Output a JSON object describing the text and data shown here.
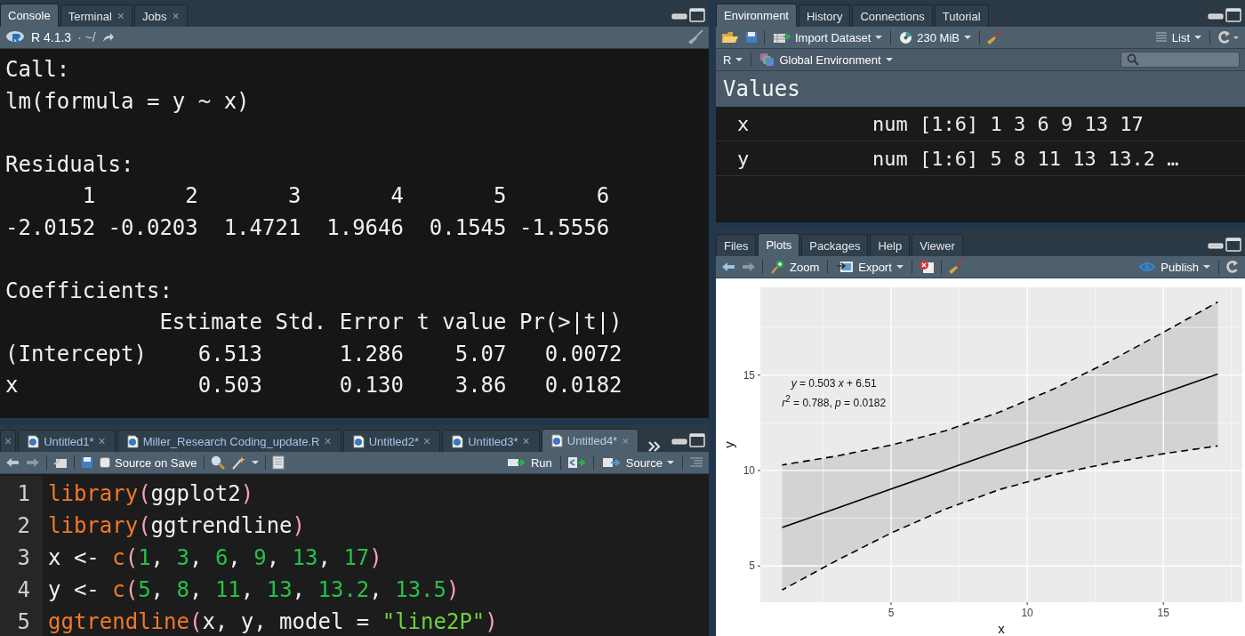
{
  "console": {
    "tabs": [
      {
        "label": "Console",
        "selected": true
      },
      {
        "label": "Terminal",
        "selected": false,
        "close": "×"
      },
      {
        "label": "Jobs",
        "selected": false,
        "close": "×"
      }
    ],
    "toolbar": {
      "version": "R 4.1.3",
      "path": "· ~/"
    },
    "output": [
      [
        "Call:",
        "lm(formula = y ~ x)"
      ],
      [
        "Residuals:",
        "      1       2       3       4       5       6 ",
        "-2.0152 -0.0203  1.4721  1.9646  0.1545 -1.5556 "
      ],
      [
        "Coefficients:",
        "            Estimate Std. Error t value Pr(>|t|)",
        "(Intercept)    6.513      1.286    5.07   0.0072",
        "x              0.503      0.130    3.86   0.0182"
      ]
    ]
  },
  "editor": {
    "tabs": [
      {
        "close": "×",
        "selected": false
      },
      {
        "label": "Untitled1*",
        "close": "×",
        "selected": false
      },
      {
        "label": "Miller_Research Coding_update.R",
        "close": "×",
        "selected": false
      },
      {
        "label": "Untitled2*",
        "close": "×",
        "selected": false
      },
      {
        "label": "Untitled3*",
        "close": "×",
        "selected": false
      },
      {
        "label": "Untitled4*",
        "close": "×",
        "selected": true
      }
    ],
    "toolbar": {
      "source_on_save": {
        "label": "Source on Save",
        "checked": false
      },
      "run": "Run",
      "source": "Source"
    },
    "lines": [
      {
        "number": "1",
        "tokens": [
          {
            "kind": "func",
            "text": "library"
          },
          {
            "kind": "paren",
            "text": "("
          },
          {
            "kind": "plain",
            "text": "ggplot2"
          },
          {
            "kind": "paren",
            "text": ")"
          }
        ]
      },
      {
        "number": "2",
        "tokens": [
          {
            "kind": "func",
            "text": "library"
          },
          {
            "kind": "paren",
            "text": "("
          },
          {
            "kind": "plain",
            "text": "ggtrendline"
          },
          {
            "kind": "paren",
            "text": ")"
          }
        ]
      },
      {
        "number": "3",
        "tokens": [
          {
            "kind": "plain",
            "text": "x <- "
          },
          {
            "kind": "func",
            "text": "c"
          },
          {
            "kind": "paren",
            "text": "("
          },
          {
            "kind": "number",
            "text": "1"
          },
          {
            "kind": "plain",
            "text": ", "
          },
          {
            "kind": "number",
            "text": "3"
          },
          {
            "kind": "plain",
            "text": ", "
          },
          {
            "kind": "number",
            "text": "6"
          },
          {
            "kind": "plain",
            "text": ", "
          },
          {
            "kind": "number",
            "text": "9"
          },
          {
            "kind": "plain",
            "text": ", "
          },
          {
            "kind": "number",
            "text": "13"
          },
          {
            "kind": "plain",
            "text": ", "
          },
          {
            "kind": "number",
            "text": "17"
          },
          {
            "kind": "paren",
            "text": ")"
          }
        ]
      },
      {
        "number": "4",
        "tokens": [
          {
            "kind": "plain",
            "text": "y <- "
          },
          {
            "kind": "func",
            "text": "c"
          },
          {
            "kind": "paren",
            "text": "("
          },
          {
            "kind": "number",
            "text": "5"
          },
          {
            "kind": "plain",
            "text": ", "
          },
          {
            "kind": "number",
            "text": "8"
          },
          {
            "kind": "plain",
            "text": ", "
          },
          {
            "kind": "number",
            "text": "11"
          },
          {
            "kind": "plain",
            "text": ", "
          },
          {
            "kind": "number",
            "text": "13"
          },
          {
            "kind": "plain",
            "text": ", "
          },
          {
            "kind": "number",
            "text": "13.2"
          },
          {
            "kind": "plain",
            "text": ", "
          },
          {
            "kind": "number",
            "text": "13.5"
          },
          {
            "kind": "paren",
            "text": ")"
          }
        ]
      },
      {
        "number": "5",
        "tokens": [
          {
            "kind": "func",
            "text": "ggtrendline"
          },
          {
            "kind": "paren",
            "text": "("
          },
          {
            "kind": "plain",
            "text": "x, y, model = "
          },
          {
            "kind": "string",
            "text": "\"line2P\""
          },
          {
            "kind": "paren",
            "text": ")"
          }
        ]
      }
    ]
  },
  "environment": {
    "tabs": [
      {
        "label": "Environment",
        "selected": true
      },
      {
        "label": "History",
        "selected": false
      },
      {
        "label": "Connections",
        "selected": false
      },
      {
        "label": "Tutorial",
        "selected": false
      }
    ],
    "toolbar": {
      "import": "Import Dataset",
      "memory": "230 MiB",
      "view": "List"
    },
    "scope": {
      "language": "R",
      "environment": "Global Environment"
    },
    "section": "Values",
    "rows": [
      {
        "name": "x",
        "value": "num [1:6] 1 3 6 9 13 17"
      },
      {
        "name": "y",
        "value": "num [1:6] 5 8 11 13 13.2 …"
      }
    ]
  },
  "plots": {
    "tabs": [
      {
        "label": "Files",
        "selected": false
      },
      {
        "label": "Plots",
        "selected": true
      },
      {
        "label": "Packages",
        "selected": false
      },
      {
        "label": "Help",
        "selected": false
      },
      {
        "label": "Viewer",
        "selected": false
      }
    ],
    "toolbar": {
      "zoom": "Zoom",
      "export": "Export",
      "publish": "Publish"
    },
    "chart_data": {
      "type": "line",
      "xlabel": "x",
      "ylabel": "y",
      "grid": true,
      "x": [
        1,
        3,
        5,
        7,
        9,
        11,
        13,
        15,
        17
      ],
      "series": [
        {
          "color": "#000000",
          "line_style": "solid",
          "values": [
            7.01,
            8.02,
            9.03,
            10.03,
            11.04,
            12.04,
            13.05,
            14.06,
            15.06
          ]
        },
        {
          "color": "#000000",
          "line_style": "dashed",
          "values": [
            3.74,
            5.28,
            6.72,
            7.98,
            9.01,
            9.79,
            10.39,
            10.88,
            11.29
          ]
        },
        {
          "color": "#000000",
          "line_style": "dashed",
          "values": [
            10.29,
            10.76,
            11.33,
            12.08,
            13.07,
            14.29,
            15.71,
            17.24,
            18.83
          ]
        }
      ],
      "xlim": [
        0.2,
        17.9
      ],
      "ylim": [
        3.1,
        19.6
      ],
      "xticks": [
        5,
        10,
        15
      ],
      "yticks": [
        5,
        10,
        15
      ],
      "annotations": [
        "*y* = 0.503 *x* + 6.51",
        "*r*$^{2}$ = 0.788,  *p* = 0.0182"
      ]
    }
  }
}
